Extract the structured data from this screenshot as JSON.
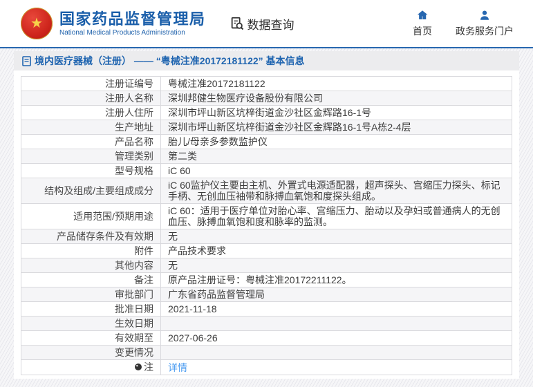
{
  "header": {
    "agency_name_zh": "国家药品监督管理局",
    "agency_name_en": "National Medical Products Administration",
    "data_query_label": "数据查询",
    "nav": [
      {
        "label": "首页",
        "icon": "home-icon"
      },
      {
        "label": "政务服务门户",
        "icon": "user-icon"
      }
    ]
  },
  "page": {
    "title": "境内医疗器械（注册） —— “粤械注准20172181122” 基本信息"
  },
  "colors": {
    "brand_blue": "#1b5faa",
    "header_border": "#2767b0",
    "link_blue": "#4b9cf0",
    "row_alt_bg": "#f5f5f7",
    "title_bar_bg": "#ececee",
    "emblem_red": "#d0281e"
  },
  "table": {
    "rows": [
      {
        "label": "注册证编号",
        "value": "粤械注准20172181122"
      },
      {
        "label": "注册人名称",
        "value": "深圳邦健生物医疗设备股份有限公司"
      },
      {
        "label": "注册人住所",
        "value": "深圳市坪山新区坑梓街道金沙社区金辉路16-1号"
      },
      {
        "label": "生产地址",
        "value": "深圳市坪山新区坑梓街道金沙社区金辉路16-1号A栋2-4层"
      },
      {
        "label": "产品名称",
        "value": "胎儿/母亲多参数监护仪"
      },
      {
        "label": "管理类别",
        "value": "第二类"
      },
      {
        "label": "型号规格",
        "value": "iC 60"
      },
      {
        "label": "结构及组成/主要组成成分",
        "value": "iC 60监护仪主要由主机、外置式电源适配器，超声探头、宫缩压力探头、标记手柄、无创血压袖带和脉搏血氧饱和度探头组成。"
      },
      {
        "label": "适用范围/预期用途",
        "value": "iC 60：适用于医疗单位对胎心率、宫缩压力、胎动以及孕妇或普通病人的无创血压、脉搏血氧饱和度和脉率的监测。"
      },
      {
        "label": "产品储存条件及有效期",
        "value": "无"
      },
      {
        "label": "附件",
        "value": "产品技术要求"
      },
      {
        "label": "其他内容",
        "value": "无"
      },
      {
        "label": "备注",
        "value": "原产品注册证号：粤械注准20172211122。"
      },
      {
        "label": "审批部门",
        "value": "广东省药品监督管理局"
      },
      {
        "label": "批准日期",
        "value": "2021-11-18"
      },
      {
        "label": "生效日期",
        "value": ""
      },
      {
        "label": "有效期至",
        "value": "2027-06-26"
      },
      {
        "label": "变更情况",
        "value": ""
      },
      {
        "label": "注",
        "value": "详情",
        "link": true,
        "label_icon": "comment-icon"
      }
    ]
  }
}
